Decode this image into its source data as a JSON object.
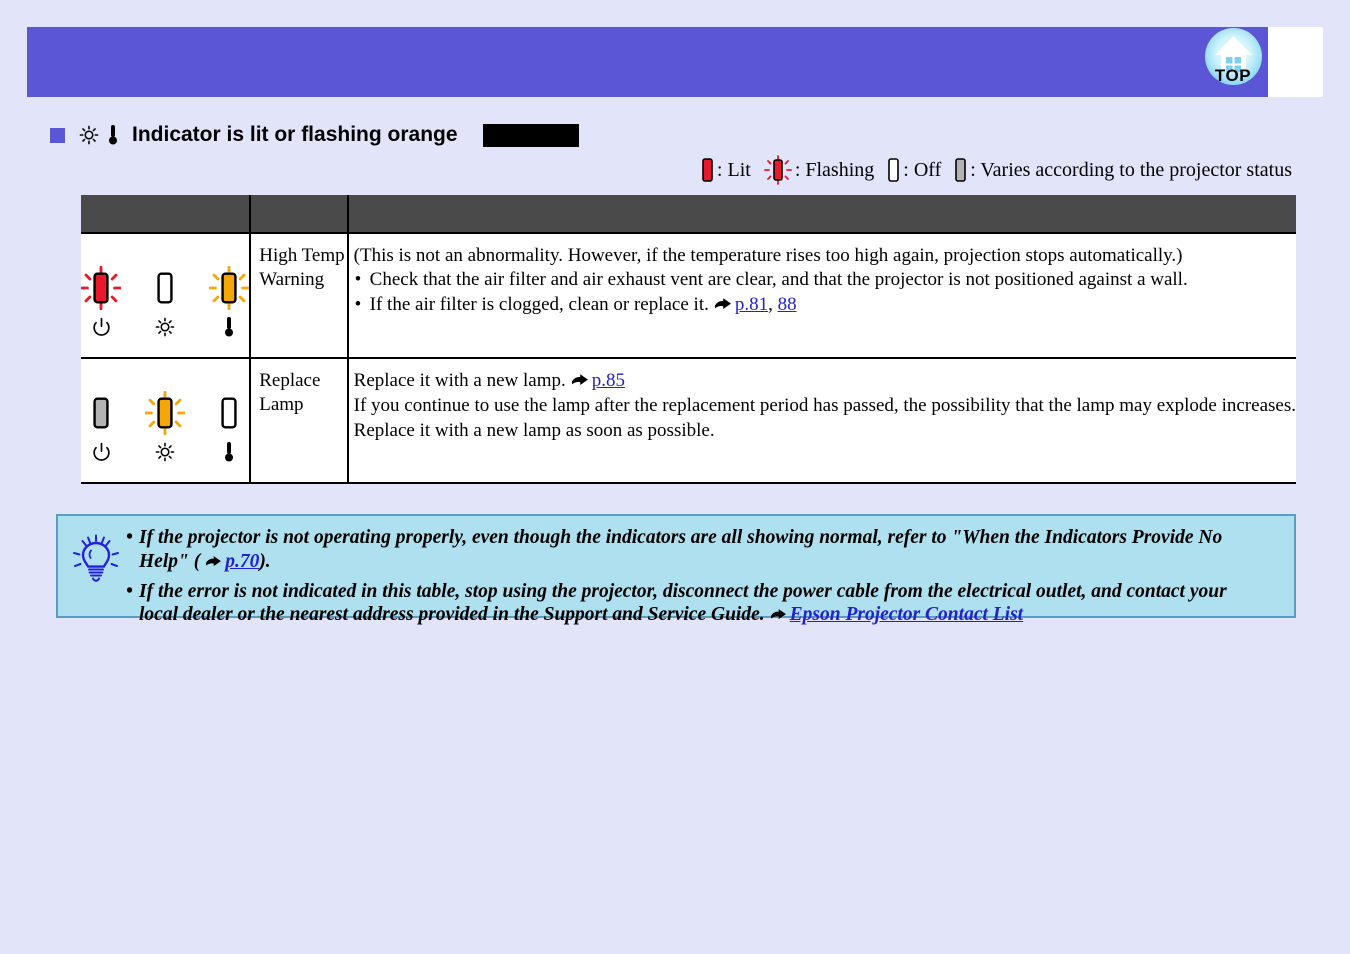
{
  "page": {
    "background_color": "#e2e4fa",
    "band_color": "#5a56d6"
  },
  "header": {
    "top_button_label": "TOP",
    "top_button_icon": "home-house-icon"
  },
  "heading": {
    "bullet_icon": "purple-square-marker",
    "lamp_icon": "lamp-indicator-icon",
    "temp_icon": "thermometer-indicator-icon",
    "text": "Indicator is lit or flashing orange",
    "redaction_block": ""
  },
  "legend": {
    "lit": ": Lit",
    "flashing": ": Flashing",
    "off": ": Off",
    "varies": ": Varies according to the projector status",
    "colors": {
      "lit": "#e8192c",
      "flashing_orange": "#f5a70a",
      "off": "#ffffff",
      "varies": "#b3b3b3"
    }
  },
  "table": {
    "header_color": "#4a4a4a",
    "columns": [
      "",
      "",
      ""
    ],
    "rows": [
      {
        "indicators": [
          {
            "symbol": "power-icon",
            "state": "flashing",
            "color": "#e8192c"
          },
          {
            "symbol": "lamp-icon",
            "state": "off",
            "color": "#ffffff"
          },
          {
            "symbol": "temperature-icon",
            "state": "flashing",
            "color": "#f5a70a"
          }
        ],
        "status": "High Temp Warning",
        "remedy": {
          "intro": "(This is not an abnormality. However, if the temperature rises too high again, projection stops automatically.)",
          "bullets": [
            {
              "text": "Check that the air filter and air exhaust vent are clear, and that the projector is not positioned against a wall.",
              "links": []
            },
            {
              "text": "If the air filter is clogged, clean or replace it.",
              "links": [
                "p.81",
                "88"
              ],
              "link_separator": ", "
            }
          ]
        }
      },
      {
        "indicators": [
          {
            "symbol": "power-icon",
            "state": "varies",
            "color": "#b3b3b3"
          },
          {
            "symbol": "lamp-icon",
            "state": "flashing",
            "color": "#f5a70a"
          },
          {
            "symbol": "temperature-icon",
            "state": "off",
            "color": "#ffffff"
          }
        ],
        "status": "Replace Lamp",
        "remedy": {
          "line1_pre": "Replace it with a new lamp.",
          "line1_link": "p.85",
          "line2": "If you continue to use the lamp after the replacement period has passed, the possibility that the lamp may explode increases.",
          "line3": "Replace it with a new lamp as soon as possible."
        }
      }
    ]
  },
  "tip_box": {
    "background_color": "#aee0ef",
    "border_color": "#5a9dc0",
    "icon": "lightbulb-icon",
    "items": [
      {
        "line1": "If the projector is not operating properly, even though the indicators are all showing normal, refer to \"When the Indicators Provide No",
        "line2_pre": "Help\" (",
        "line2_link": "p.70",
        "line2_post": ")."
      },
      {
        "line1": "If the error is not indicated in this table, stop using the projector, disconnect the power cable from the electrical outlet, and contact your",
        "line2_pre": "local dealer or the nearest address provided in the Support and Service Guide.",
        "line2_link": "Epson Projector Contact List",
        "line2_post": ""
      }
    ]
  }
}
